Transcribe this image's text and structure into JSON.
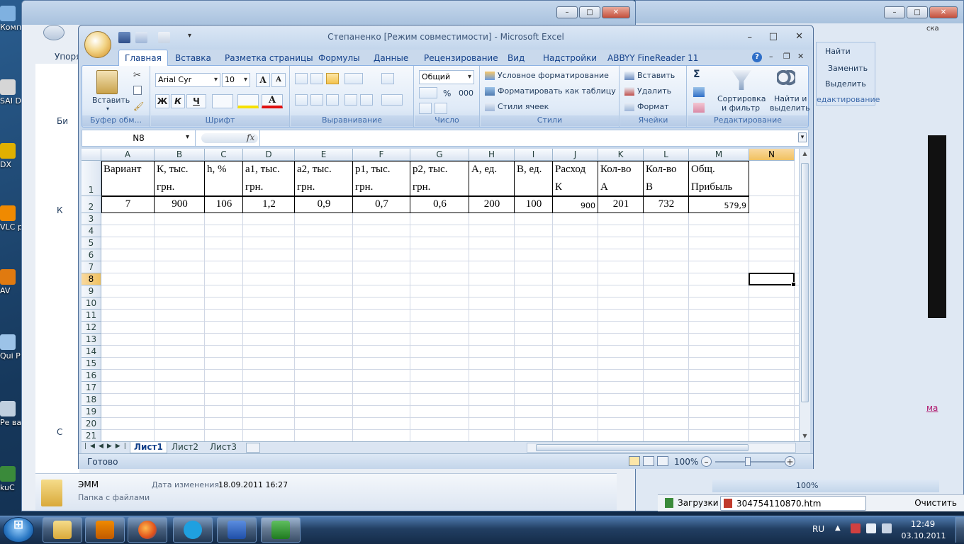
{
  "desktop": {
    "icons": [
      {
        "label": "Компь"
      },
      {
        "label": "SAI Dr."
      },
      {
        "label": "DX"
      },
      {
        "label": "VLC p"
      },
      {
        "label": "AV"
      },
      {
        "label": "Qui P"
      },
      {
        "label": "Ре ва"
      },
      {
        "label": "kuC"
      }
    ]
  },
  "explorer": {
    "menu_fragment": "Упоря",
    "folder_name": "ЭММ",
    "modified_label": "Дата изменения:",
    "modified_value": "18.09.2011 16:27",
    "folder_type": "Папка с файлами",
    "nav_fragments": [
      "Би",
      "К",
      "С"
    ]
  },
  "browser": {
    "toolbar": {
      "find_label": "Найти",
      "replace_label": "Заменить",
      "select_label": "Выделить",
      "group_label": "едактирование"
    },
    "link_fragment": "ма",
    "zoom": "100%",
    "downloads_label": "Загрузки",
    "file_label": "304754110870.htm",
    "clear_label": "Очистить",
    "frag_ka": "ска"
  },
  "excel": {
    "title": "Степаненко  [Режим совместимости] - Microsoft Excel",
    "tabs": [
      "Главная",
      "Вставка",
      "Разметка страницы",
      "Формулы",
      "Данные",
      "Рецензирование",
      "Вид",
      "Надстройки",
      "ABBYY FineReader 11"
    ],
    "ribbon": {
      "paste_label": "Вставить",
      "clipboard_group": "Буфер обм...",
      "font_name": "Arial Cyr",
      "font_size": "10",
      "font_group": "Шрифт",
      "bold": "Ж",
      "italic": "К",
      "underline": "Ч",
      "align_group": "Выравнивание",
      "number_format": "Общий",
      "percent": "%",
      "thousands": "000",
      "number_group": "Число",
      "cond_format": "Условное форматирование",
      "format_table": "Форматировать как таблицу",
      "cell_styles": "Стили ячеек",
      "styles_group": "Стили",
      "insert": "Вставить",
      "delete": "Удалить",
      "format": "Формат",
      "cells_group": "Ячейки",
      "sort_filter_1": "Сортировка",
      "sort_filter_2": "и фильтр",
      "find_select_1": "Найти и",
      "find_select_2": "выделить",
      "editing_group": "Редактирование",
      "sigma": "Σ"
    },
    "namebox": "N8",
    "fx": "fx",
    "columns": [
      "A",
      "B",
      "C",
      "D",
      "E",
      "F",
      "G",
      "H",
      "I",
      "J",
      "K",
      "L",
      "M",
      "N"
    ],
    "rows": [
      "1",
      "2",
      "3",
      "4",
      "5",
      "6",
      "7",
      "8",
      "9",
      "10",
      "11",
      "12",
      "13",
      "14",
      "15",
      "16",
      "17",
      "18",
      "19",
      "20",
      "21"
    ],
    "header_row": [
      [
        "Вариант",
        ""
      ],
      [
        "К,  тыс.",
        "грн."
      ],
      [
        "h, %",
        ""
      ],
      [
        "а1,  тыс.",
        "грн."
      ],
      [
        "а2,   тыс.",
        "грн."
      ],
      [
        "р1,   тыс.",
        "грн."
      ],
      [
        "р2,   тыс.",
        "грн."
      ],
      [
        "А, ед.",
        ""
      ],
      [
        "В, ед.",
        ""
      ],
      [
        "Расход",
        "К"
      ],
      [
        "Кол-во",
        "А"
      ],
      [
        "Кол-во",
        "В"
      ],
      [
        "Общ.",
        "Прибыль"
      ]
    ],
    "data_row": [
      "7",
      "900",
      "106",
      "1,2",
      "0,9",
      "0,7",
      "0,6",
      "200",
      "100",
      "900",
      "201",
      "732",
      "579,9"
    ],
    "sheet_tabs": [
      "Лист1",
      "Лист2",
      "Лист3"
    ],
    "active_sheet": "Лист1",
    "status": "Готово",
    "zoom": "100%"
  },
  "taskbar": {
    "lang": "RU",
    "time": "12:49",
    "date": "03.10.2011"
  }
}
